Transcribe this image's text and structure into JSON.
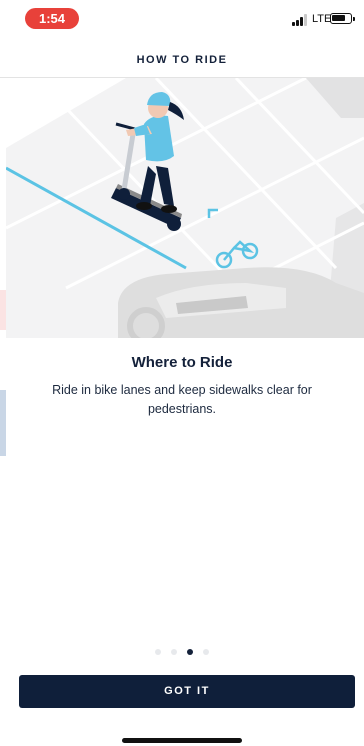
{
  "status_bar": {
    "time": "1:54",
    "network": "LTE",
    "battery_level": 0.75,
    "signal_bars": 3,
    "time_pill_color": "#e8413a"
  },
  "header": {
    "title": "HOW TO RIDE"
  },
  "slide": {
    "illustration": "scooter-in-bike-lane-illustration",
    "title": "Where to Ride",
    "body": "Ride in bike lanes and keep sidewalks clear for pedestrians."
  },
  "pager": {
    "total": 4,
    "active_index": 2
  },
  "primary_button": {
    "label": "GOT IT",
    "color": "#0f1f3a"
  },
  "colors": {
    "accent_lane": "#5bc3e4",
    "rider_shirt": "#63c3e6",
    "text_primary": "#14213a"
  }
}
